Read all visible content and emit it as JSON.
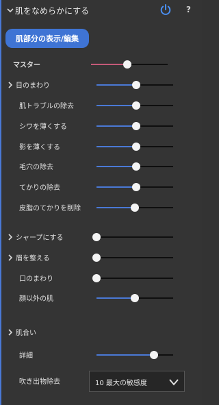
{
  "header": {
    "title": "肌をなめらかにする",
    "help_label": "?"
  },
  "skin_button": {
    "label": "肌部分の表示/編集"
  },
  "colors": {
    "accent_blue": "#4a79d6",
    "accent_pink": "#c45a78",
    "panel_bg": "#343434"
  },
  "sliders": [
    {
      "id": "master",
      "label": "マスター",
      "value": 0.47,
      "color": "#c45a78",
      "expandable": false
    },
    {
      "id": "eyes",
      "label": "目のまわり",
      "value": 0.52,
      "color": "#4a79d6",
      "expandable": true
    },
    {
      "id": "skin-trouble",
      "label": "肌トラブルの除去",
      "value": 0.52,
      "color": "#4a79d6",
      "expandable": false
    },
    {
      "id": "wrinkles",
      "label": "シワを薄くする",
      "value": 0.52,
      "color": "#4a79d6",
      "expandable": false
    },
    {
      "id": "shadows",
      "label": "影を薄くする",
      "value": 0.52,
      "color": "#4a79d6",
      "expandable": false
    },
    {
      "id": "pores",
      "label": "毛穴の除去",
      "value": 0.52,
      "color": "#4a79d6",
      "expandable": false
    },
    {
      "id": "shine",
      "label": "てかりの除去",
      "value": 0.52,
      "color": "#4a79d6",
      "expandable": false
    },
    {
      "id": "sebum",
      "label": "皮脂のてかりを削除",
      "value": 0.5,
      "color": "#4a79d6",
      "expandable": false
    },
    {
      "id": "sharpen",
      "label": "シャープにする",
      "value": 0.0,
      "color": "#4a79d6",
      "expandable": true
    },
    {
      "id": "eyebrows",
      "label": "眉を整える",
      "value": 0.0,
      "color": "#4a79d6",
      "expandable": true
    },
    {
      "id": "mouth",
      "label": "口のまわり",
      "value": 0.0,
      "color": "#4a79d6",
      "expandable": false
    },
    {
      "id": "other-skin",
      "label": "顔以外の肌",
      "value": 0.5,
      "color": "#4a79d6",
      "expandable": false
    },
    {
      "id": "detail",
      "label": "詳細",
      "value": 0.75,
      "color": "#4a79d6",
      "expandable": false
    }
  ],
  "skin_tone": {
    "label": "肌合い"
  },
  "breakout": {
    "label": "吹き出物除去",
    "selected": "10 最大の敏感度"
  }
}
